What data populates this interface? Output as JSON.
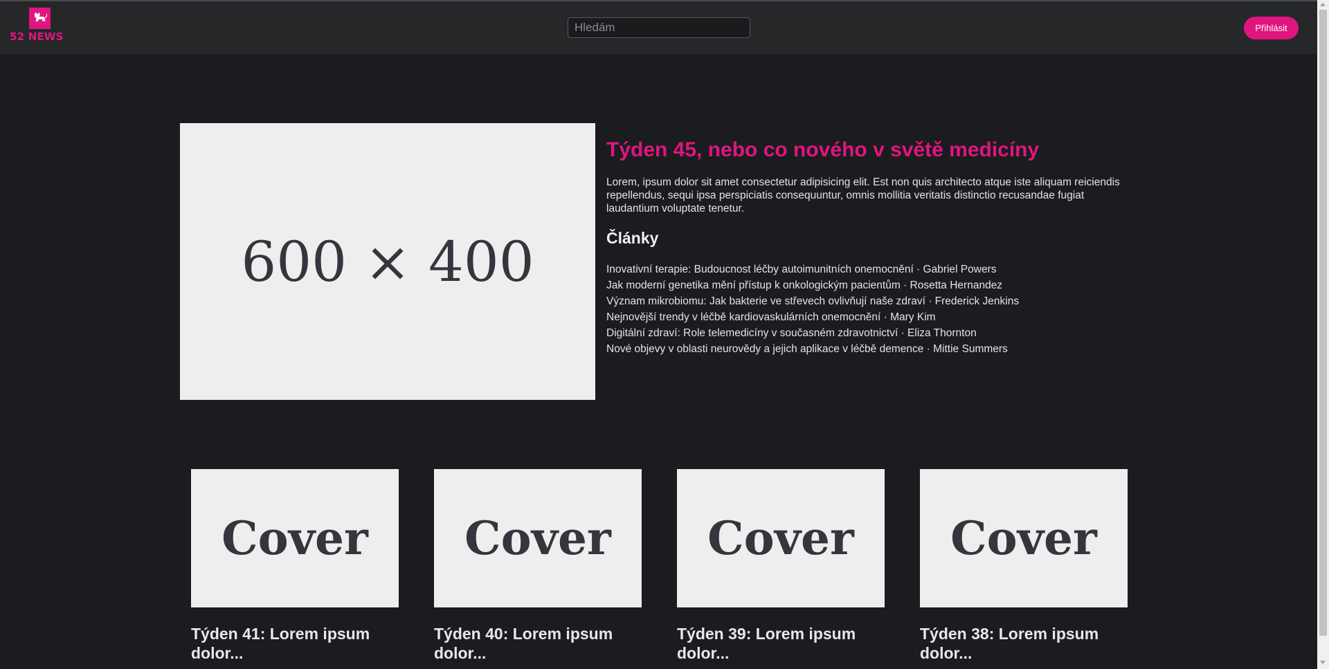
{
  "header": {
    "logo_text": "52 NEWS",
    "search_placeholder": "Hledám",
    "login_label": "Přihlásit"
  },
  "colors": {
    "accent": "#e0157f",
    "background": "#1b1c1f",
    "header_bg": "#262729"
  },
  "hero": {
    "image_label": "600 × 400",
    "title": "Týden 45, nebo co nového v světě medicíny",
    "description": "Lorem, ipsum dolor sit amet consectetur adipisicing elit. Est non quis architecto atque iste aliquam reiciendis repellendus, sequi ipsa perspiciatis consequuntur, omnis mollitia veritatis distinctio recusandae fugiat laudantium voluptate tenetur.",
    "articles_heading": "Články",
    "articles": [
      "Inovativní terapie: Budoucnost léčby autoimunitních onemocnění · Gabriel Powers",
      "Jak moderní genetika mění přístup k onkologickým pacientům · Rosetta Hernandez",
      "Význam mikrobiomu: Jak bakterie ve střevech ovlivňují naše zdraví · Frederick Jenkins",
      "Nejnovější trendy v léčbě kardiovaskulárních onemocnění · Mary Kim",
      "Digitální zdraví: Role telemedicíny v současném zdravotnictví · Eliza Thornton",
      "Nové objevy v oblasti neurovědy a jejich aplikace v léčbě demence · Mittie Summers"
    ]
  },
  "cards": [
    {
      "image_label": "Cover",
      "title": "Týden 41: Lorem ipsum dolor..."
    },
    {
      "image_label": "Cover",
      "title": "Týden 40: Lorem ipsum dolor..."
    },
    {
      "image_label": "Cover",
      "title": "Týden 39: Lorem ipsum dolor..."
    },
    {
      "image_label": "Cover",
      "title": "Týden 38: Lorem ipsum dolor..."
    }
  ],
  "icons": {
    "logo": "cat-icon"
  }
}
